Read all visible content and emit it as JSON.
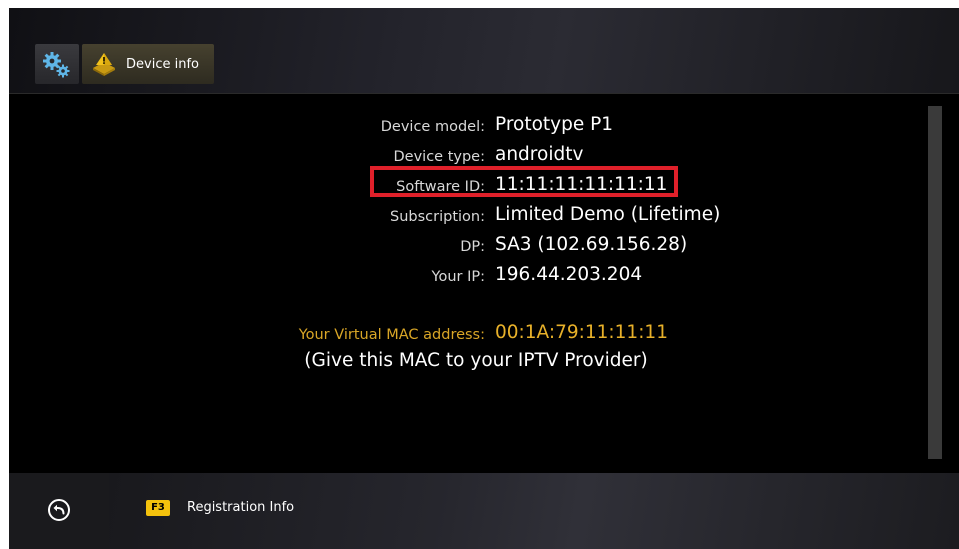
{
  "header": {
    "settings_icon": "gears-icon",
    "tab": {
      "icon": "device-info-icon",
      "label": "Device info"
    }
  },
  "device": {
    "rows": [
      {
        "label": "Device model:",
        "value": "Prototype P1"
      },
      {
        "label": "Device type:",
        "value": "androidtv"
      },
      {
        "label": "Software ID:",
        "value": "11:11:11:11:11:11"
      },
      {
        "label": "Subscription:",
        "value": "Limited Demo (Lifetime)"
      },
      {
        "label": "DP:",
        "value": "SA3 (102.69.156.28)"
      },
      {
        "label": "Your IP:",
        "value": "196.44.203.204"
      }
    ],
    "mac": {
      "label": "Your Virtual MAC address:",
      "value": "00:1A:79:11:11:11",
      "note": "(Give this MAC to your IPTV Provider)"
    }
  },
  "footer": {
    "back_icon": "back-arrow-icon",
    "f3_key": "F3",
    "f3_label": "Registration Info"
  },
  "colors": {
    "highlight": "#e0202a",
    "mac_accent": "#e8b12a",
    "f3_badge": "#f4c20d"
  }
}
